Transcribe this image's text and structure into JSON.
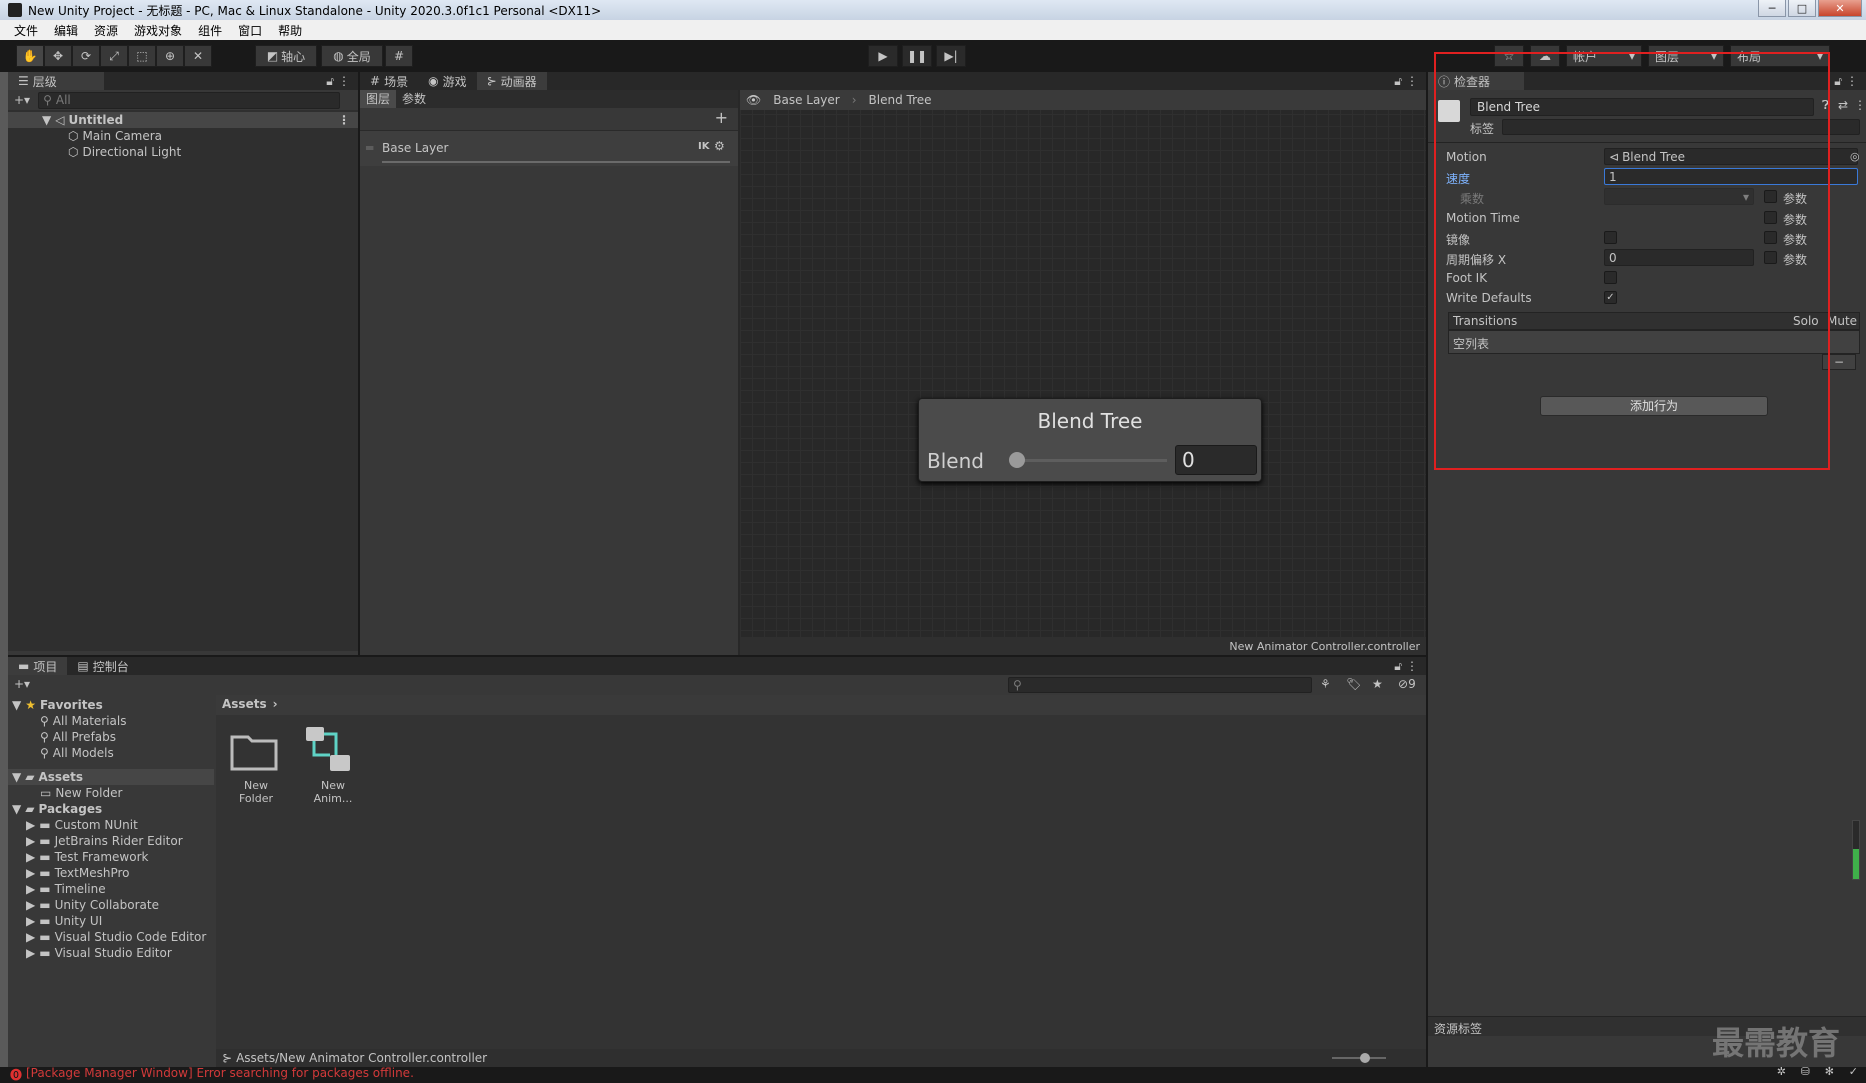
{
  "window": {
    "title": "New Unity Project - 无标题 - PC, Mac & Linux Standalone - Unity 2020.3.0f1c1 Personal <DX11>",
    "min": "─",
    "max": "□",
    "close": "✕"
  },
  "menu": [
    "文件",
    "编辑",
    "资源",
    "游戏对象",
    "组件",
    "窗口",
    "帮助"
  ],
  "toolbar": {
    "pivot": "轴心",
    "global": "全局",
    "account": "帐户",
    "layers": "图层",
    "layout": "布局"
  },
  "hierarchy": {
    "tab": "层级",
    "search_placeholder": "All",
    "scene": "Untitled",
    "items": [
      "Main Camera",
      "Directional Light"
    ]
  },
  "center_tabs": [
    "场景",
    "游戏",
    "动画器"
  ],
  "animator": {
    "left_tabs": [
      "图层",
      "参数"
    ],
    "layer": "Base Layer",
    "ik": "IK",
    "breadcrumb": [
      "Base Layer",
      "Blend Tree"
    ],
    "node_title": "Blend Tree",
    "param": "Blend",
    "value": "0",
    "slider_value": 0,
    "footer": "New Animator Controller.controller"
  },
  "inspector": {
    "tab": "检查器",
    "name": "Blend Tree",
    "tag_label": "标签",
    "motion_label": "Motion",
    "motion_value": "Blend Tree",
    "speed_label": "速度",
    "speed_value": "1",
    "multiplier_label": "乘数",
    "param_label": "参数",
    "motion_time_label": "Motion Time",
    "mirror_label": "镜像",
    "cycle_label": "周期偏移 X",
    "cycle_value": "0",
    "footik_label": "Foot IK",
    "write_defaults_label": "Write Defaults",
    "transitions_label": "Transitions",
    "solo": "Solo",
    "mute": "Mute",
    "empty_list": "空列表",
    "minus": "−",
    "add_behaviour": "添加行为",
    "asset_labels": "资源标签",
    "highlight_color": "#e02020"
  },
  "project": {
    "tabs": [
      "项目",
      "控制台"
    ],
    "favorites_label": "Favorites",
    "favorites": [
      "All Materials",
      "All Prefabs",
      "All Models"
    ],
    "assets_label": "Assets",
    "asset_folders": [
      "New Folder"
    ],
    "packages_label": "Packages",
    "packages": [
      "Custom NUnit",
      "JetBrains Rider Editor",
      "Test Framework",
      "TextMeshPro",
      "Timeline",
      "Unity Collaborate",
      "Unity UI",
      "Visual Studio Code Editor",
      "Visual Studio Editor"
    ],
    "breadcrumb": "Assets",
    "items": [
      "New Folder",
      "New Anim..."
    ],
    "hidden_count": "9",
    "path": "Assets/New Animator Controller.controller"
  },
  "status": {
    "error": "[Package Manager Window] Error searching for packages offline."
  },
  "watermark": "最需教育"
}
